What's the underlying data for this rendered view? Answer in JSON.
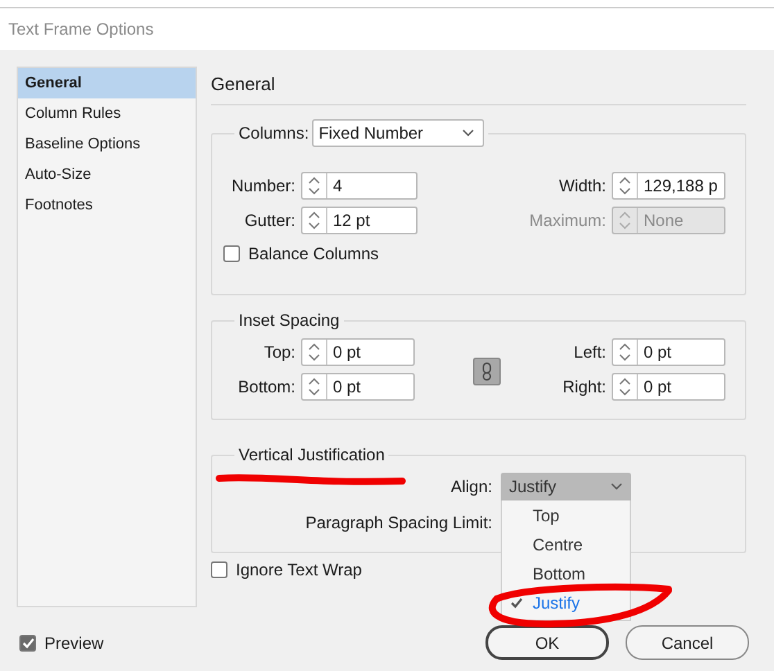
{
  "window": {
    "title": "Text Frame Options"
  },
  "sidebar": {
    "items": [
      {
        "label": "General",
        "selected": true
      },
      {
        "label": "Column Rules",
        "selected": false
      },
      {
        "label": "Baseline Options",
        "selected": false
      },
      {
        "label": "Auto-Size",
        "selected": false
      },
      {
        "label": "Footnotes",
        "selected": false
      }
    ]
  },
  "panel": {
    "heading": "General"
  },
  "columns": {
    "label": "Columns:",
    "mode": "Fixed Number",
    "fields": [
      {
        "label": "Number:",
        "value": "4",
        "disabled": false
      },
      {
        "label": "Width:",
        "value": "129,188 p",
        "disabled": false
      },
      {
        "label": "Gutter:",
        "value": "12 pt",
        "disabled": false
      },
      {
        "label": "Maximum:",
        "value": "None",
        "disabled": true
      }
    ],
    "balance": {
      "label": "Balance Columns",
      "checked": false
    }
  },
  "inset_spacing": {
    "title": "Inset Spacing",
    "fields": [
      {
        "label": "Top:",
        "value": "0 pt",
        "disabled": false
      },
      {
        "label": "Left:",
        "value": "0 pt",
        "disabled": false
      },
      {
        "label": "Bottom:",
        "value": "0 pt",
        "disabled": false
      },
      {
        "label": "Right:",
        "value": "0 pt",
        "disabled": false
      }
    ]
  },
  "vertical_justification": {
    "title": "Vertical Justification",
    "align": {
      "label": "Align:",
      "value": "Justify",
      "expanded": true,
      "options": [
        {
          "label": "Top",
          "selected": false
        },
        {
          "label": "Centre",
          "selected": false
        },
        {
          "label": "Bottom",
          "selected": false
        },
        {
          "label": "Justify",
          "selected": true
        }
      ]
    },
    "spacing_limit": {
      "label": "Paragraph Spacing Limit:"
    }
  },
  "ignore_text_wrap": {
    "label": "Ignore Text Wrap",
    "checked": false
  },
  "preview": {
    "label": "Preview",
    "checked": true
  },
  "buttons": [
    {
      "label": "OK",
      "kind": "primary"
    },
    {
      "label": "Cancel",
      "kind": "secondary"
    }
  ],
  "annotations": {
    "underline": true,
    "ellipse": true
  }
}
